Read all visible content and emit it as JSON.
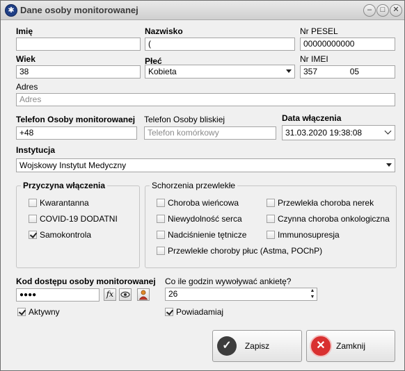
{
  "window": {
    "title": "Dane osoby monitorowanej"
  },
  "fields": {
    "imie": {
      "label": "Imię",
      "value": ""
    },
    "nazwisko": {
      "label": "Nazwisko",
      "value": "("
    },
    "pesel": {
      "label": "Nr PESEL",
      "value": "00000000000"
    },
    "wiek": {
      "label": "Wiek",
      "value": "38"
    },
    "plec": {
      "label": "Płeć",
      "value": "Kobieta"
    },
    "imei": {
      "label": "Nr IMEI",
      "value": "357              05"
    },
    "adres": {
      "label": "Adres",
      "placeholder": "Adres"
    },
    "telefon_osoby": {
      "label": "Telefon Osoby monitorowanej",
      "value": "+48"
    },
    "telefon_bliskiej": {
      "label": "Telefon Osoby bliskiej",
      "placeholder": "Telefon komórkowy"
    },
    "data_wlaczenia": {
      "label": "Data włączenia",
      "value": "31.03.2020 19:38:08"
    },
    "instytucja": {
      "label": "Instytucja",
      "value": "Wojskowy Instytut Medyczny"
    }
  },
  "przyczyna": {
    "title": "Przyczyna włączenia",
    "items": [
      {
        "label": "Kwarantanna",
        "checked": false
      },
      {
        "label": "COVID-19 DODATNI",
        "checked": false
      },
      {
        "label": "Samokontrola",
        "checked": true
      }
    ]
  },
  "schorzenia": {
    "title": "Schorzenia przewlekłe",
    "items": [
      {
        "label": "Choroba wieńcowa",
        "checked": false
      },
      {
        "label": "Przewlekła choroba nerek",
        "checked": false
      },
      {
        "label": "Niewydolność serca",
        "checked": false
      },
      {
        "label": "Czynna choroba onkologiczna",
        "checked": false
      },
      {
        "label": "Nadciśnienie tętnicze",
        "checked": false
      },
      {
        "label": "Immunosupresja",
        "checked": false
      },
      {
        "label": "Przewlekłe choroby płuc (Astma, POChP)",
        "checked": false
      }
    ]
  },
  "kod": {
    "label": "Kod dostępu osoby monitorowanej",
    "value": "●●●●"
  },
  "godziny": {
    "label": "Co ile godzin wywoływać ankietę?",
    "value": "26"
  },
  "aktywny": {
    "label": "Aktywny",
    "checked": true
  },
  "powiadamiaj": {
    "label": "Powiadamiaj",
    "checked": true
  },
  "buttons": {
    "save": "Zapisz",
    "close": "Zamknij"
  },
  "icons": {
    "fx": "fx",
    "eye": "eye-icon",
    "person": "person-icon"
  },
  "colors": {
    "title_icon": "#1f3f86",
    "save_icon": "#3d3d3d",
    "close_icon": "#d93030"
  }
}
